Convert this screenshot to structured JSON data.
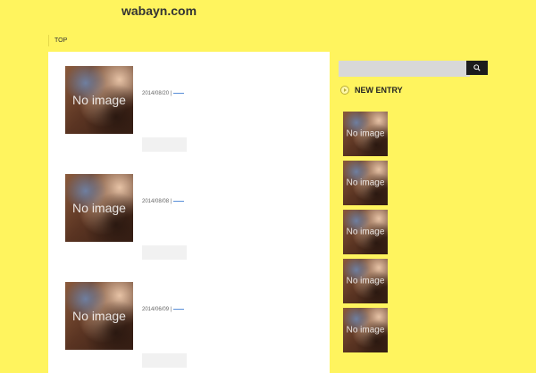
{
  "site": {
    "title": "wabayn.com"
  },
  "breadcrumb": {
    "top": "TOP"
  },
  "posts": [
    {
      "thumb_label": "No image",
      "date": "2014/08/20",
      "sep": "|"
    },
    {
      "thumb_label": "No image",
      "date": "2014/08/08",
      "sep": "|"
    },
    {
      "thumb_label": "No image",
      "date": "2014/06/09",
      "sep": "|"
    }
  ],
  "sidebar": {
    "search": {
      "placeholder": ""
    },
    "new_entry": {
      "title": "NEW ENTRY",
      "items": [
        {
          "thumb_label": "No image"
        },
        {
          "thumb_label": "No image"
        },
        {
          "thumb_label": "No image"
        },
        {
          "thumb_label": "No image"
        },
        {
          "thumb_label": "No image"
        }
      ]
    }
  }
}
